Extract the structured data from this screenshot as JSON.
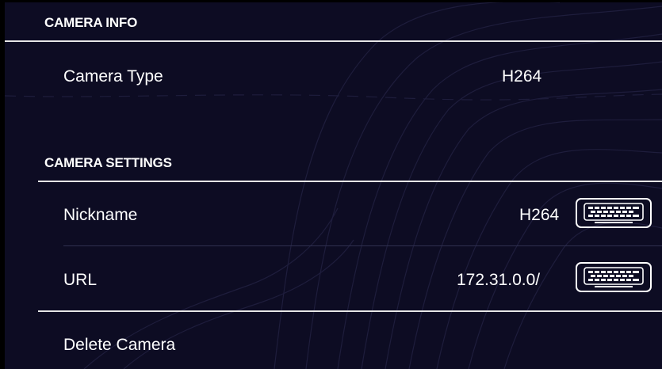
{
  "colors": {
    "panel_background": "#0d0c23",
    "text": "#ffffff",
    "divider": "#e6e6e6",
    "row_divider": "#2f3050"
  },
  "camera_info": {
    "header": "CAMERA INFO",
    "camera_type_label": "Camera Type",
    "camera_type_value": "H264"
  },
  "camera_settings": {
    "header": "CAMERA SETTINGS",
    "nickname_label": "Nickname",
    "nickname_value": "H264",
    "url_label": "URL",
    "url_value": "172.31.0.0/",
    "edit_icon": "keyboard-icon"
  },
  "actions": {
    "delete_label": "Delete Camera"
  }
}
